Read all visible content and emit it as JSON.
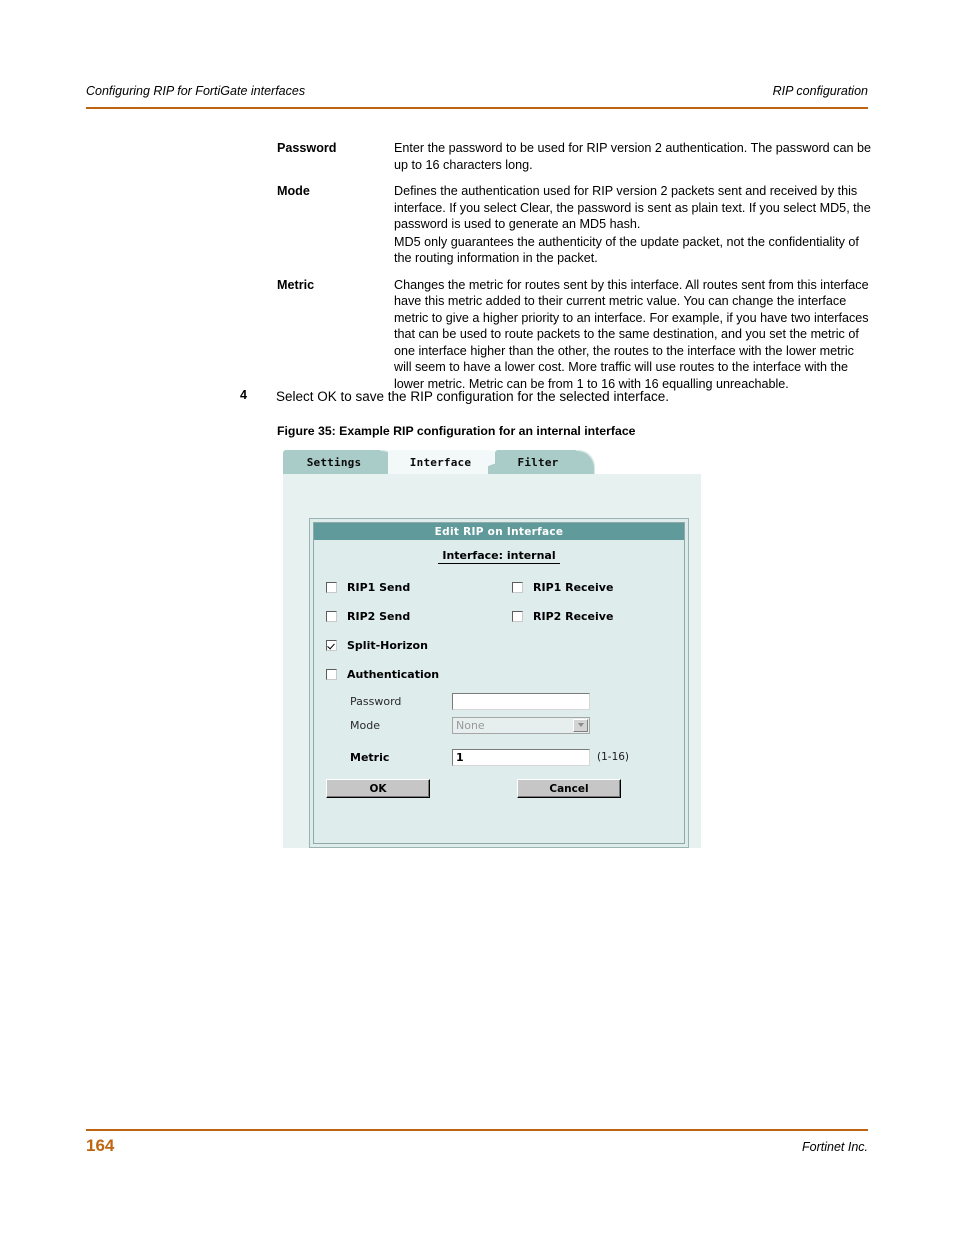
{
  "header": {
    "left": "Configuring RIP for FortiGate interfaces",
    "right": "RIP configuration"
  },
  "definitions": [
    {
      "term": "Password",
      "paragraphs": [
        "Enter the password to be used for RIP version 2 authentication. The password can be up to 16 characters long."
      ]
    },
    {
      "term": "Mode",
      "paragraphs": [
        "Defines the authentication used for RIP version 2 packets sent and received by this interface. If you select Clear, the password is sent as plain text. If you select MD5, the password is used to generate an MD5 hash.",
        "MD5 only guarantees the authenticity of the update packet, not the confidentiality of the routing information in the packet."
      ]
    },
    {
      "term": "Metric",
      "paragraphs": [
        "Changes the metric for routes sent by this interface. All routes sent from this interface have this metric added to their current metric value. You can change the interface metric to give a higher priority to an interface. For example, if you have two interfaces that can be used to route packets to the same destination, and you set the metric of one interface higher than the other, the routes to the interface with the lower metric will seem to have a lower cost. More traffic will use routes to the interface with the lower metric. Metric can be from 1 to 16 with 16 equalling unreachable."
      ]
    }
  ],
  "step": {
    "number": "4",
    "text": "Select OK to save the RIP configuration for the selected interface."
  },
  "figure": {
    "caption": "Figure 35: Example RIP configuration for an internal interface",
    "tabs": [
      {
        "label": "Settings",
        "active": false
      },
      {
        "label": "Interface",
        "active": true
      },
      {
        "label": "Filter",
        "active": false
      }
    ],
    "dialog": {
      "title": "Edit RIP on Interface",
      "interface_line": "Interface: internal",
      "checkboxes": [
        {
          "label": "RIP1 Send",
          "checked": false
        },
        {
          "label": "RIP1 Receive",
          "checked": false
        },
        {
          "label": "RIP2 Send",
          "checked": false
        },
        {
          "label": "RIP2 Receive",
          "checked": false
        },
        {
          "label": "Split-Horizon",
          "checked": true
        },
        {
          "label": "Authentication",
          "checked": false
        }
      ],
      "password": {
        "label": "Password",
        "value": ""
      },
      "mode": {
        "label": "Mode",
        "value": "None"
      },
      "metric": {
        "label": "Metric",
        "value": "1",
        "hint": "(1-16)"
      },
      "ok_label": "OK",
      "cancel_label": "Cancel"
    }
  },
  "footer": {
    "page_number": "164",
    "company": "Fortinet Inc."
  },
  "colors": {
    "rule": "#bf6512",
    "tab": "#a9ccc8",
    "tab_active": "#f2f9f8",
    "titlebar": "#619a9a",
    "panel": "#dfecec"
  }
}
